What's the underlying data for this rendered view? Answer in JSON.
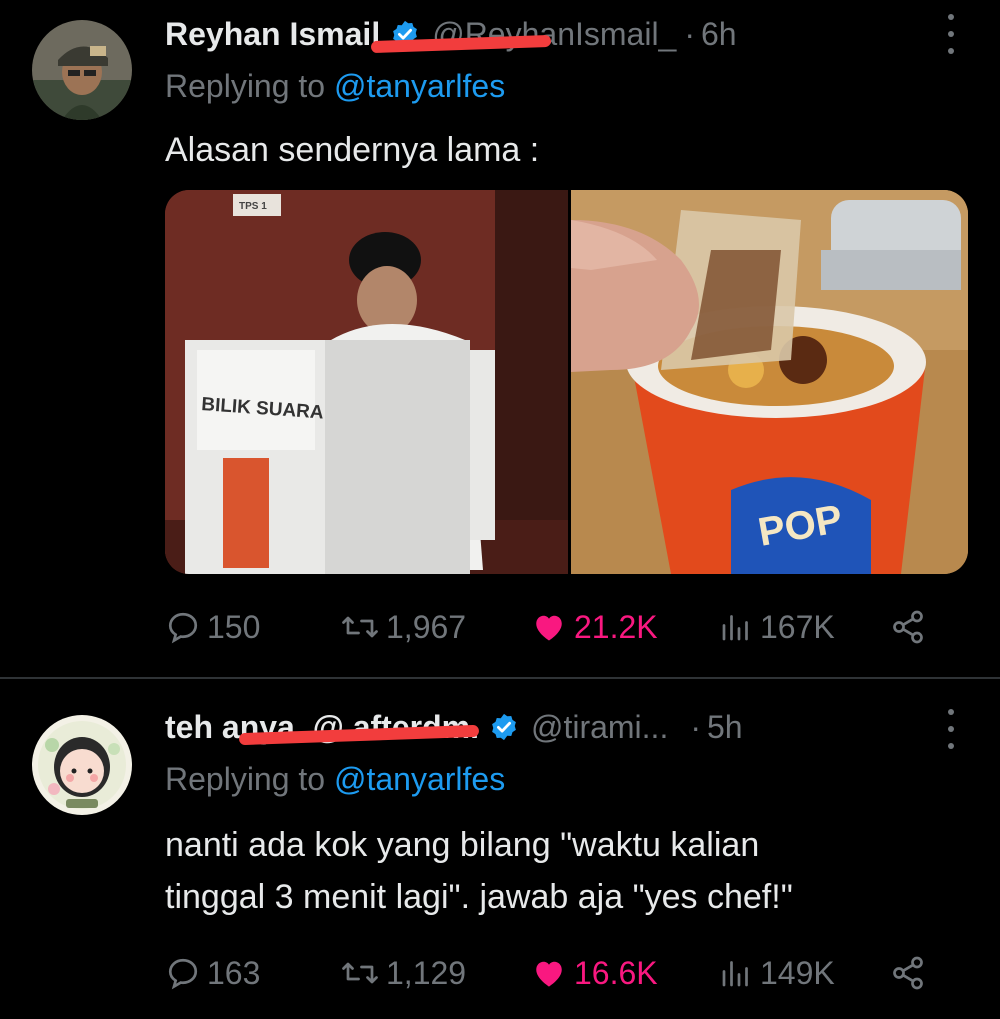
{
  "tweets": [
    {
      "display_name": "Reyhan Ismail",
      "handle": "@ReyhanIsmail_",
      "separator": "·",
      "time": "6h",
      "replying_prefix": "Replying to",
      "replying_to": "@tanyarlfes",
      "text": "Alasan sendernya lama :",
      "media": {
        "left_image": {
          "booth_label": "BILIK SUARA",
          "sign": "TPS 1"
        },
        "right_image": {
          "brand": "POP"
        }
      },
      "stats": {
        "replies": "150",
        "retweets": "1,967",
        "likes": "21.2K",
        "views": "167K"
      }
    },
    {
      "display_name": "teh anya, @ afterdm.",
      "handle": "@tirami...",
      "separator": "·",
      "time": "5h",
      "replying_prefix": "Replying to",
      "replying_to": "@tanyarlfes",
      "text_lines": [
        "nanti ada kok yang bilang \"waktu kalian",
        "tinggal 3 menit lagi\". jawab aja \"yes chef!\""
      ],
      "stats": {
        "replies": "163",
        "retweets": "1,129",
        "likes": "16.6K",
        "views": "149K"
      }
    }
  ],
  "colors": {
    "background": "#000000",
    "text_primary": "#e7e9ea",
    "text_secondary": "#71767b",
    "link": "#1d9bf0",
    "like": "#f91880",
    "verified": "#1d9bf0",
    "redaction": "#f23d3d"
  },
  "icons": [
    "more-icon",
    "verified-icon",
    "reply-icon",
    "retweet-icon",
    "heart-icon",
    "views-icon",
    "share-icon"
  ]
}
